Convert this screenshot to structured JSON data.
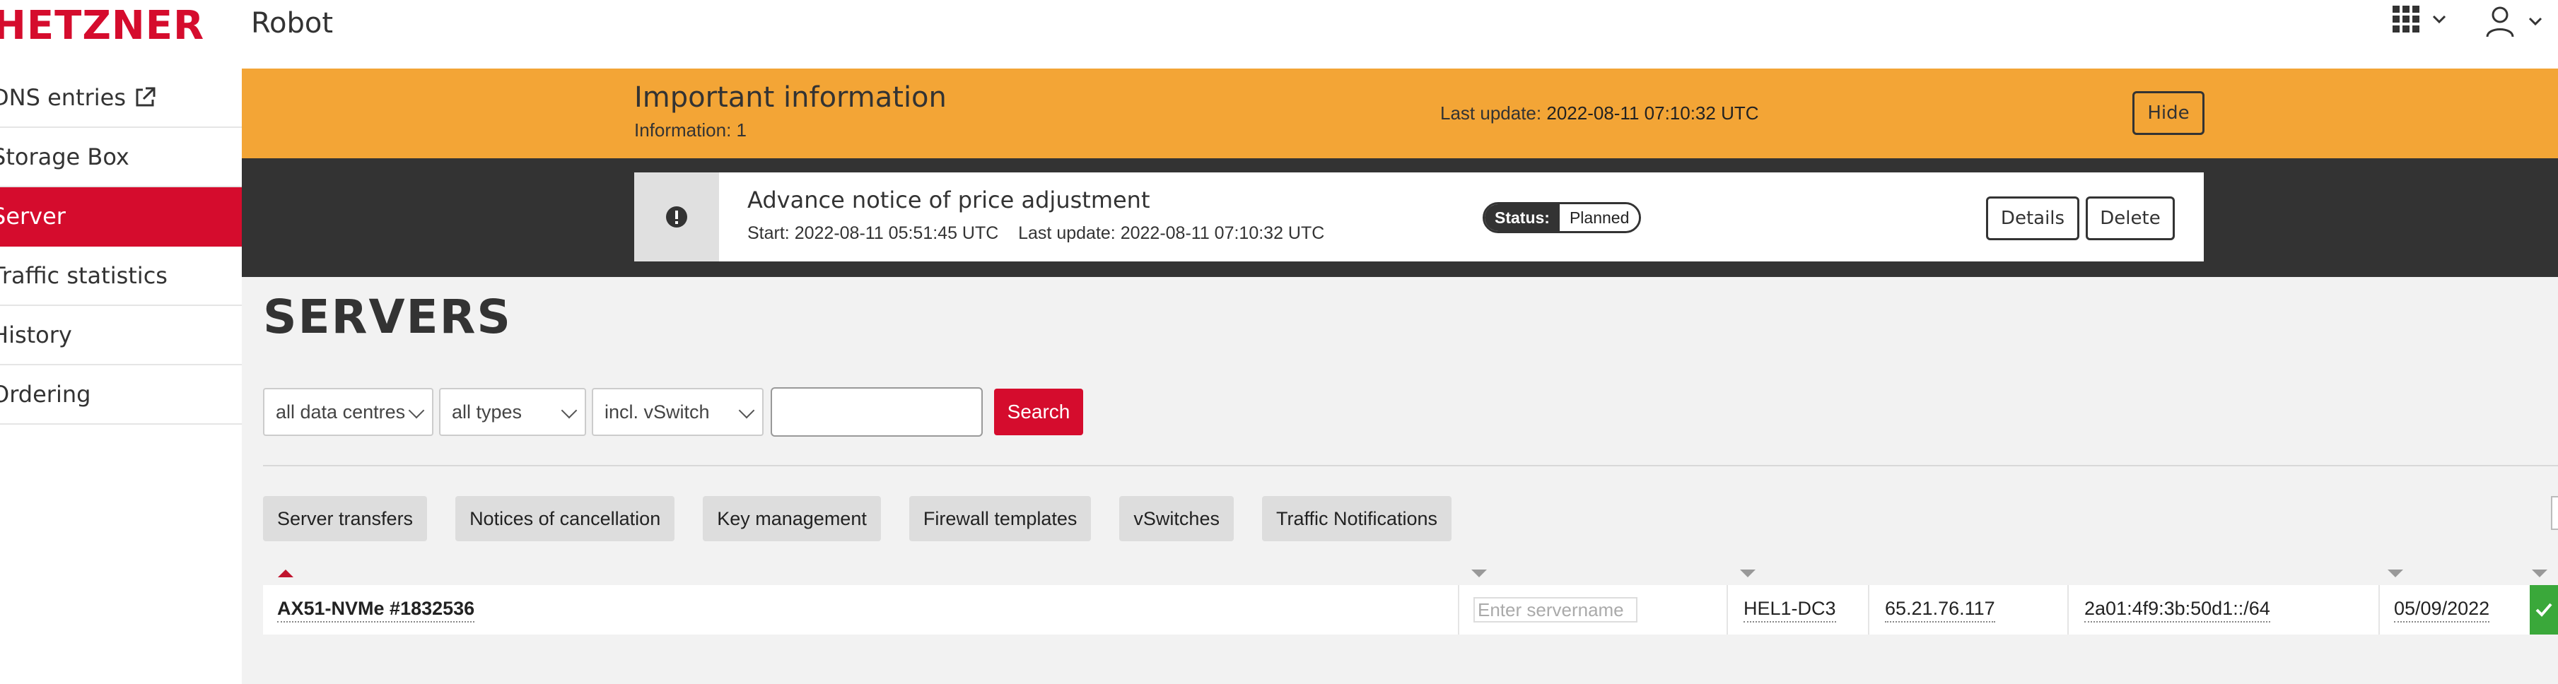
{
  "header": {
    "brand": "HETZNER",
    "app_name": "Robot",
    "apps_icon": "grid-icon",
    "user_icon": "user-icon"
  },
  "sidebar": {
    "items": [
      {
        "label": "DNS entries",
        "icon": "external-link-icon",
        "active": false
      },
      {
        "label": "Storage Box",
        "active": false
      },
      {
        "label": "Server",
        "active": true
      },
      {
        "label": "Traffic statistics",
        "active": false
      },
      {
        "label": "History",
        "active": false
      },
      {
        "label": "Ordering",
        "active": false
      }
    ]
  },
  "info_bar": {
    "title": "Important information",
    "information_label": "Information:",
    "information_count": "1",
    "last_update_label": "Last update:",
    "last_update_value": "2022-08-11 07:10:32 UTC",
    "hide_label": "Hide",
    "background": "#f3a536"
  },
  "notice": {
    "icon": "exclamation-circle-icon",
    "title": "Advance notice of price adjustment",
    "start_label": "Start:",
    "start_value": "2022-08-11 05:51:45 UTC",
    "last_update_label": "Last update:",
    "last_update_value": "2022-08-11 07:10:32 UTC",
    "status_label": "Status:",
    "status_value": "Planned",
    "details_label": "Details",
    "delete_label": "Delete"
  },
  "page_title": "SERVERS",
  "filters": {
    "datacenter": "all data centres",
    "type": "all types",
    "vswitch": "incl. vSwitch",
    "search_value": "",
    "search_button": "Search"
  },
  "tabs": [
    "Server transfers",
    "Notices of cancellation",
    "Key management",
    "Firewall templates",
    "vSwitches",
    "Traffic Notifications"
  ],
  "servers": [
    {
      "product": "AX51-NVMe #1832536",
      "servername_placeholder": "Enter servername",
      "datacenter": "HEL1-DC3",
      "ipv4": "65.21.76.117",
      "ipv6": "2a01:4f9:3b:50d1::/64",
      "date": "05/09/2022",
      "status_icon": "check-icon"
    }
  ],
  "colors": {
    "brand_red": "#d50c2d",
    "dark": "#333333",
    "success_green": "#3aa83a"
  }
}
